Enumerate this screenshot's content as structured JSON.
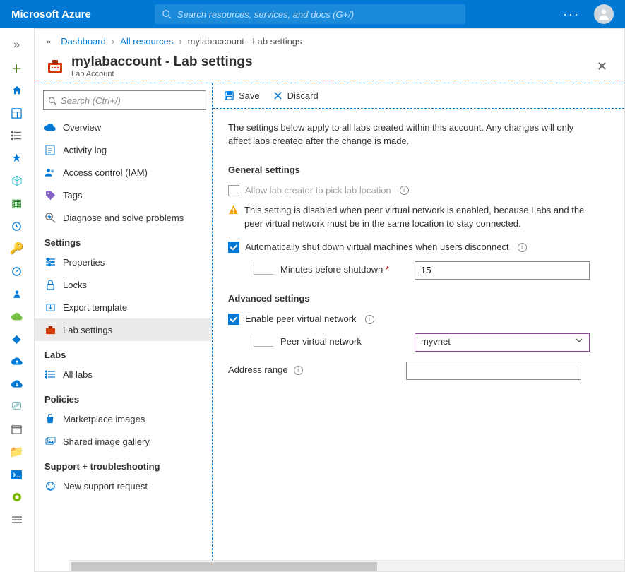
{
  "brand": "Microsoft Azure",
  "search_placeholder": "Search resources, services, and docs (G+/)",
  "breadcrumb": {
    "a": "Dashboard",
    "b": "All resources",
    "c": "mylabaccount - Lab settings"
  },
  "page_title": "mylabaccount - Lab settings",
  "page_subtitle": "Lab Account",
  "nav_search_placeholder": "Search (Ctrl+/)",
  "nav": {
    "overview": "Overview",
    "activity": "Activity log",
    "iam": "Access control (IAM)",
    "tags": "Tags",
    "diag": "Diagnose and solve problems",
    "grp_settings": "Settings",
    "properties": "Properties",
    "locks": "Locks",
    "export": "Export template",
    "labsettings": "Lab settings",
    "grp_labs": "Labs",
    "alllabs": "All labs",
    "grp_policies": "Policies",
    "marketplace": "Marketplace images",
    "sharedgal": "Shared image gallery",
    "grp_support": "Support + troubleshooting",
    "newreq": "New support request"
  },
  "cmd": {
    "save": "Save",
    "discard": "Discard"
  },
  "content": {
    "desc": "The settings below apply to all labs created within this account. Any changes will only affect labs created after the change is made.",
    "general_title": "General settings",
    "allow_location": "Allow lab creator to pick lab location",
    "warn_text": "This setting is disabled when peer virtual network is enabled, because Labs and the peer virtual network must be in the same location to stay connected.",
    "auto_shutdown": "Automatically shut down virtual machines when users disconnect",
    "minutes_label": "Minutes before shutdown",
    "minutes_value": "15",
    "advanced_title": "Advanced settings",
    "enable_peer": "Enable peer virtual network",
    "peer_label": "Peer virtual network",
    "peer_value": "myvnet",
    "addr_label": "Address range"
  }
}
